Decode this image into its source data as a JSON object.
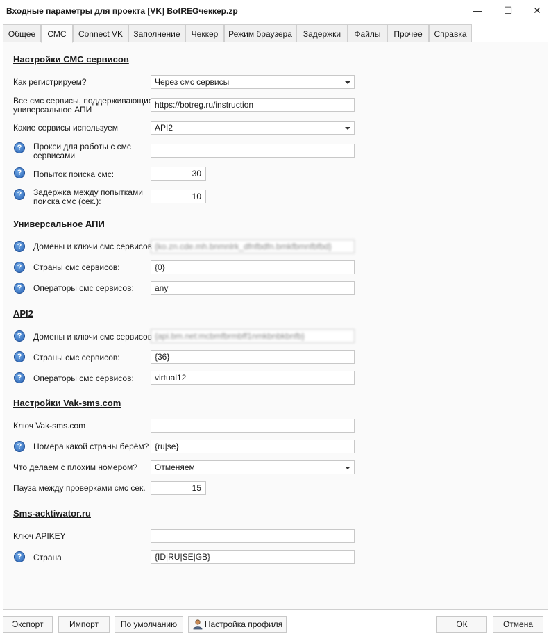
{
  "window": {
    "title": "Входные параметры для проекта [VK] BotREGчеккер.zp",
    "minimize": "—",
    "maximize": "☐",
    "close": "✕"
  },
  "tabs": [
    "Общее",
    "СМС",
    "Connect VK",
    "Заполнение",
    "Чеккер",
    "Режим браузера",
    "Задержки",
    "Файлы",
    "Прочее",
    "Справка"
  ],
  "active_tab": "СМС",
  "sections": {
    "sms_settings": "Настройки СМС сервисов",
    "universal_api": "Универсальное АПИ",
    "api2": "API2",
    "vak": "Настройки Vak-sms.com",
    "activator": "Sms-acktiwator.ru"
  },
  "fields": {
    "how_register": {
      "label": "Как регистрируем?",
      "value": "Через смс сервисы"
    },
    "all_services": {
      "label_line1": "Все смс сервисы, поддерживающие",
      "label_line2": "универсальное АПИ",
      "value": "https://botreg.ru/instruction"
    },
    "services_used": {
      "label": "Какие сервисы используем",
      "value": "API2"
    },
    "proxy": {
      "label_line1": "Прокси для работы с смс",
      "label_line2": "сервисами",
      "value": ""
    },
    "attempts": {
      "label": "Попыток поиска смс:",
      "value": "30"
    },
    "delay": {
      "label_line1": "Задержка между попытками",
      "label_line2": "поиска смс (сек.):",
      "value": "10"
    },
    "ua_domains": {
      "label": "Домены и ключи смс сервисов:",
      "value": "{ko.zn.cde.mh.bnmnlrk_dfnfbdfn.bmkfbmnfbfbd}"
    },
    "ua_countries": {
      "label": "Страны смс сервисов:",
      "value": "{0}"
    },
    "ua_operators": {
      "label": "Операторы смс сервисов:",
      "value": "any"
    },
    "api2_domains": {
      "label": "Домены и ключи смс сервисов:",
      "value": "{api.bm.net:mcbmfbrmbff1nmkbnbkbnfb}"
    },
    "api2_countries": {
      "label": "Страны смс сервисов:",
      "value": "{36}"
    },
    "api2_operators": {
      "label": "Операторы смс сервисов:",
      "value": "virtual12"
    },
    "vak_key": {
      "label": "Ключ Vak-sms.com",
      "value": ""
    },
    "vak_country": {
      "label": "Номера какой страны берём?",
      "value": "{ru|se}"
    },
    "vak_bad_number": {
      "label": "Что делаем с плохим номером?",
      "value": "Отменяем"
    },
    "vak_pause": {
      "label": "Пауза между проверками смс сек.",
      "value": "15"
    },
    "act_key": {
      "label": "Ключ APIKEY",
      "value": ""
    },
    "act_country": {
      "label": "Страна",
      "value": "{ID|RU|SE|GB}"
    }
  },
  "help_glyph": "?",
  "buttons": {
    "export": "Экспорт",
    "import": "Импорт",
    "defaults": "По умолчанию",
    "profile": "Настройка профиля",
    "ok": "ОК",
    "cancel": "Отмена"
  }
}
